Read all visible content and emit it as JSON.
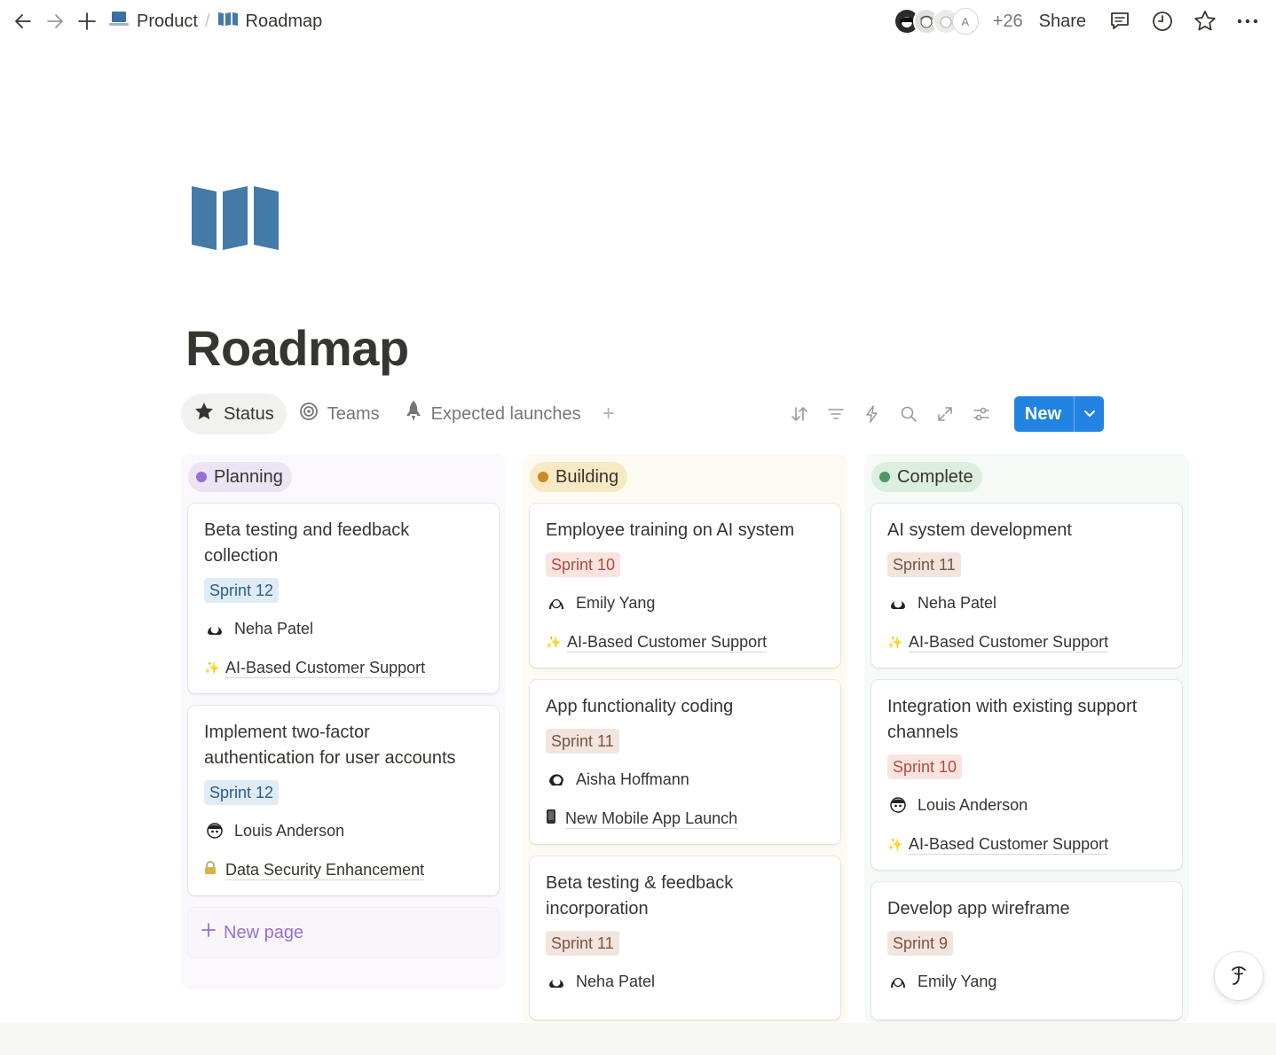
{
  "topbar": {
    "breadcrumb": [
      {
        "label": "Product",
        "icon": "laptop-icon"
      },
      {
        "label": "Roadmap",
        "icon": "map-icon"
      }
    ],
    "avatar_letter": "A",
    "extra_count": "+26",
    "share_label": "Share"
  },
  "page": {
    "title": "Roadmap",
    "icon": "map-icon",
    "icon_color": "#447aa6"
  },
  "views": {
    "tabs": [
      {
        "label": "Status",
        "icon": "star-icon",
        "active": true
      },
      {
        "label": "Teams",
        "icon": "target-icon",
        "active": false
      },
      {
        "label": "Expected launches",
        "icon": "rocket-icon",
        "active": false
      }
    ],
    "new_label": "New",
    "accent_color": "#2383e2"
  },
  "board": {
    "columns": [
      {
        "label": "Planning",
        "color": "#9a6dd7",
        "cards": [
          {
            "title": "Beta testing and feedback collection",
            "sprint": "Sprint 12",
            "assignee": "Neha Patel",
            "project": "AI-Based Customer Support",
            "project_icon": "sparkle-icon"
          },
          {
            "title": "Implement two-factor authentication for user accounts",
            "sprint": "Sprint 12",
            "assignee": "Louis Anderson",
            "project": "Data Security Enhancement",
            "project_icon": "lock-icon"
          }
        ],
        "new_page_label": "New page"
      },
      {
        "label": "Building",
        "color": "#c68b24",
        "cards": [
          {
            "title": "Employee training on AI system",
            "sprint": "Sprint 10",
            "assignee": "Emily Yang",
            "project": "AI-Based Customer Support",
            "project_icon": "sparkle-icon"
          },
          {
            "title": "App functionality coding",
            "sprint": "Sprint 11",
            "assignee": "Aisha Hoffmann",
            "project": "New Mobile App Launch",
            "project_icon": "phone-icon"
          },
          {
            "title": "Beta testing & feedback incorporation",
            "sprint": "Sprint 11",
            "assignee": "Neha Patel"
          }
        ]
      },
      {
        "label": "Complete",
        "color": "#4d9a63",
        "cards": [
          {
            "title": "AI system development",
            "sprint": "Sprint 11",
            "assignee": "Neha Patel",
            "project": "AI-Based Customer Support",
            "project_icon": "sparkle-icon"
          },
          {
            "title": "Integration with existing support channels",
            "sprint": "Sprint 10",
            "assignee": "Louis Anderson",
            "project": "AI-Based Customer Support",
            "project_icon": "sparkle-icon"
          },
          {
            "title": "Develop app wireframe",
            "sprint": "Sprint 9",
            "assignee": "Emily Yang"
          }
        ]
      }
    ]
  }
}
